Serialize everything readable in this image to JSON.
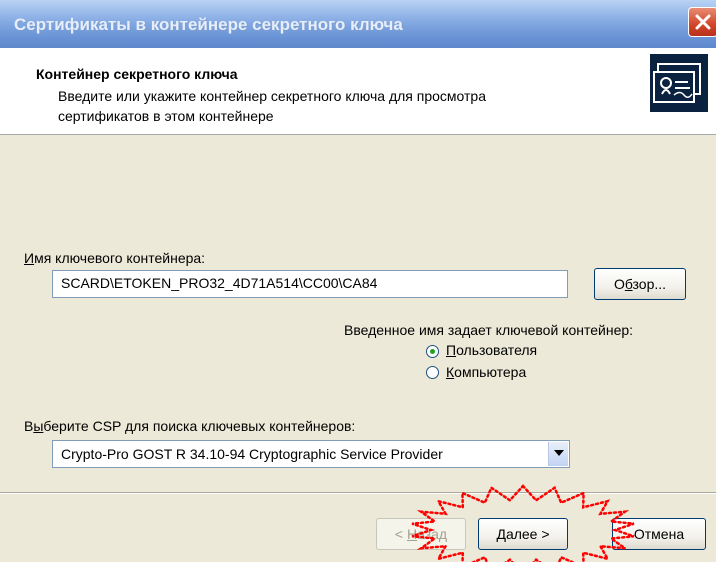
{
  "window": {
    "title": "Сертификаты в контейнере секретного ключа",
    "close_icon": "close-icon"
  },
  "header": {
    "title": "Контейнер секретного ключа",
    "subtitle": "Введите или укажите контейнер секретного ключа для просмотра сертификатов в этом контейнере",
    "icon": "certificate-icon"
  },
  "container": {
    "label_first": "И",
    "label_rest": "мя ключевого контейнера:",
    "value": "SCARD\\ETOKEN_PRO32_4D71A514\\CC00\\CA84",
    "browse_pre": "О",
    "browse_u": "б",
    "browse_post": "зор..."
  },
  "container_type": {
    "label": "Введенное имя задает ключевой контейнер:",
    "options": [
      {
        "u": "П",
        "rest": "ользователя",
        "selected": true
      },
      {
        "u": "К",
        "rest": "омпьютера",
        "selected": false
      }
    ]
  },
  "csp": {
    "label_pre": "В",
    "label_u": "ы",
    "label_post": "берите CSP для поиска ключевых контейнеров:",
    "selected": "Crypto-Pro GOST R 34.10-94 Cryptographic Service Provider"
  },
  "footer": {
    "back": {
      "pre": "< ",
      "u": "Н",
      "post": "азад"
    },
    "next": {
      "pre": "",
      "u": "Д",
      "post": "алее >"
    },
    "cancel": "Отмена"
  },
  "colors": {
    "titlebar": "#6f98d8",
    "close": "#d2452a",
    "annotation": "#ff0000",
    "radio_dot": "#21a121"
  }
}
